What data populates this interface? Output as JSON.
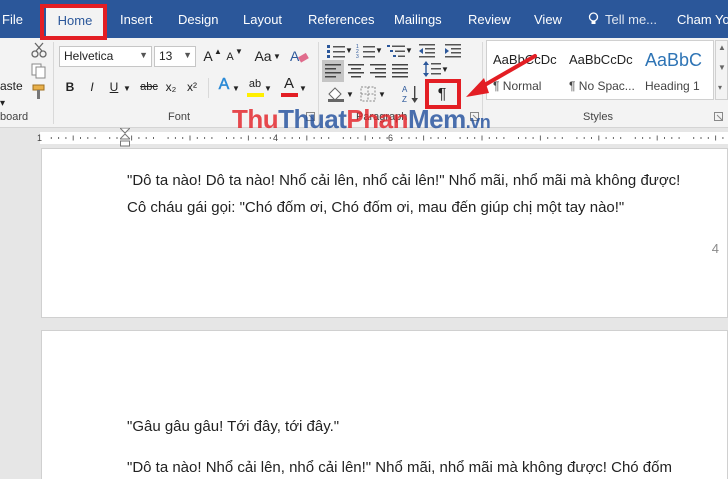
{
  "tabs": [
    "File",
    "Home",
    "Insert",
    "Design",
    "Layout",
    "References",
    "Mailings",
    "Review",
    "View"
  ],
  "tell_me": "Tell me...",
  "user": "Cham Yo",
  "clipboard": {
    "paste_label": "aste",
    "group_label": "board"
  },
  "font": {
    "family": "Helvetica",
    "size": "13",
    "grow_label": "A",
    "shrink_label": "A",
    "case_label": "Aa",
    "bold": "B",
    "italic": "I",
    "underline": "U",
    "strike": "abc",
    "subscript": "x₂",
    "superscript": "x²",
    "effects_label": "A",
    "highlight_label": "ab",
    "color_label": "A",
    "group_label": "Font"
  },
  "paragraph": {
    "pilcrow": "¶",
    "group_label": "Paragraph"
  },
  "styles": {
    "items": [
      {
        "preview": "AaBbCcDc",
        "name": "¶ Normal"
      },
      {
        "preview": "AaBbCcDc",
        "name": "¶ No Spac..."
      },
      {
        "preview": "AaBbC",
        "name": "Heading 1"
      }
    ],
    "group_label": "Styles"
  },
  "watermark": {
    "part1": "Thu",
    "part2": "Thuat",
    "part3": "Phan",
    "part4": "Mem",
    "part5": ".vn"
  },
  "ruler": {
    "start": "1",
    "n2": "2",
    "n4": "4",
    "n6": "6",
    "n8": "8"
  },
  "page1": {
    "lines": [
      "\"Dô ta nào! Dô ta nào! Nhổ cải lên, nhổ cải lên!\" Nhổ mãi, nhổ mãi mà không được!",
      "Cô cháu gái gọi: \"Chó đốm ơi, Chó đốm ơi, mau đến giúp chị một tay nào!\""
    ],
    "page_number": "4"
  },
  "page2": {
    "lines": [
      "\"Gâu gâu gâu! Tới đây, tới đây.\"",
      "\"Dô ta nào! Nhổ cải lên, nhổ cải lên!\" Nhổ mãi, nhổ mãi mà không được! Chó đốm"
    ]
  },
  "colors": {
    "accent": "#2b579a",
    "annotation": "#e31e24",
    "watermark_red": "#e31e24",
    "watermark_blue": "#1f4e9c"
  }
}
